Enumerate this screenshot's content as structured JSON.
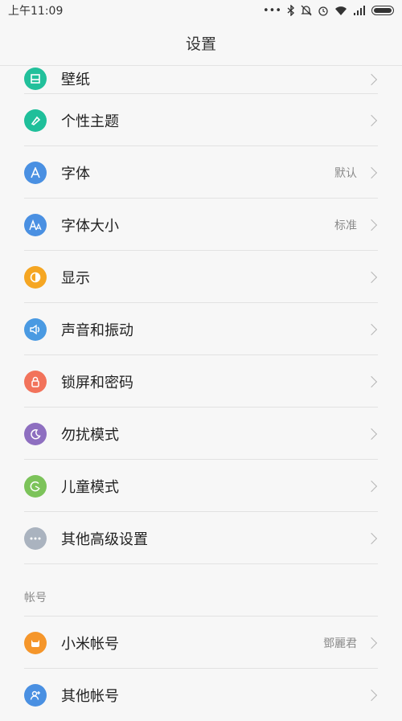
{
  "status": {
    "time": "上午11:09",
    "icons": [
      "more-icon",
      "bluetooth-icon",
      "mute-icon",
      "alarm-icon",
      "wifi-icon",
      "signal-icon",
      "battery-icon"
    ]
  },
  "header": {
    "title": "设置"
  },
  "items": [
    {
      "label": "壁纸",
      "value": "",
      "icon": "wallpaper-icon",
      "color": "#22c09b"
    },
    {
      "label": "个性主题",
      "value": "",
      "icon": "theme-icon",
      "color": "#1fbf9a"
    },
    {
      "label": "字体",
      "value": "默认",
      "icon": "font-icon",
      "color": "#4a90e2"
    },
    {
      "label": "字体大小",
      "value": "标准",
      "icon": "font-size-icon",
      "color": "#4a90e2"
    },
    {
      "label": "显示",
      "value": "",
      "icon": "display-icon",
      "color": "#f5a623"
    },
    {
      "label": "声音和振动",
      "value": "",
      "icon": "sound-icon",
      "color": "#4a9ae2"
    },
    {
      "label": "锁屏和密码",
      "value": "",
      "icon": "lock-icon",
      "color": "#f2735b"
    },
    {
      "label": "勿扰模式",
      "value": "",
      "icon": "moon-icon",
      "color": "#8e6fc0"
    },
    {
      "label": "儿童模式",
      "value": "",
      "icon": "child-mode-icon",
      "color": "#7cc35a"
    },
    {
      "label": "其他高级设置",
      "value": "",
      "icon": "more-settings-icon",
      "color": "#aab3bf"
    }
  ],
  "account_section": {
    "title": "帐号",
    "items": [
      {
        "label": "小米帐号",
        "value": "鄧麗君",
        "icon": "mi-account-icon",
        "color": "#f5962b"
      },
      {
        "label": "其他帐号",
        "value": "",
        "icon": "other-account-icon",
        "color": "#4a90e2"
      }
    ]
  }
}
